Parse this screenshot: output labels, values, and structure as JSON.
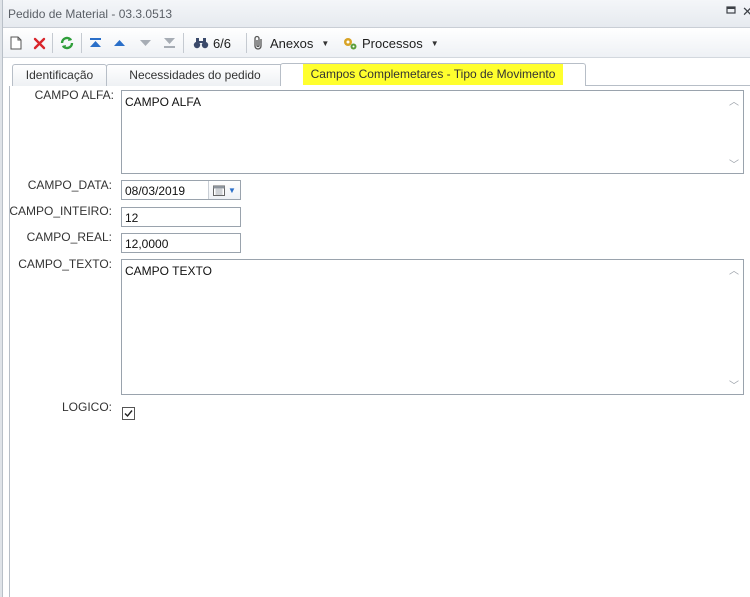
{
  "window": {
    "title": "Pedido de Material - 03.3.0513"
  },
  "toolbar": {
    "record_counter": "6/6",
    "attachments_label": "Anexos",
    "processes_label": "Processos"
  },
  "tabs": [
    {
      "label": "Identificação",
      "active": false
    },
    {
      "label": "Necessidades do pedido",
      "active": false
    },
    {
      "label": "Campos Complemetares - Tipo de Movimento",
      "active": true
    }
  ],
  "form": {
    "campo_alfa": {
      "label": "CAMPO ALFA:",
      "value": "CAMPO ALFA"
    },
    "campo_data": {
      "label": "CAMPO_DATA:",
      "value": "08/03/2019"
    },
    "campo_inteiro": {
      "label": "CAMPO_INTEIRO:",
      "value": "12"
    },
    "campo_real": {
      "label": "CAMPO_REAL:",
      "value": "12,0000"
    },
    "campo_texto": {
      "label": "CAMPO_TEXTO:",
      "value": "CAMPO TEXTO"
    },
    "logico": {
      "label": "LOGICO:",
      "checked": true
    }
  },
  "colors": {
    "tab_highlight": "#ffff2e",
    "delete_red": "#d9252b",
    "refresh_green": "#2f9e3a",
    "nav_blue": "#2a6fc9"
  }
}
